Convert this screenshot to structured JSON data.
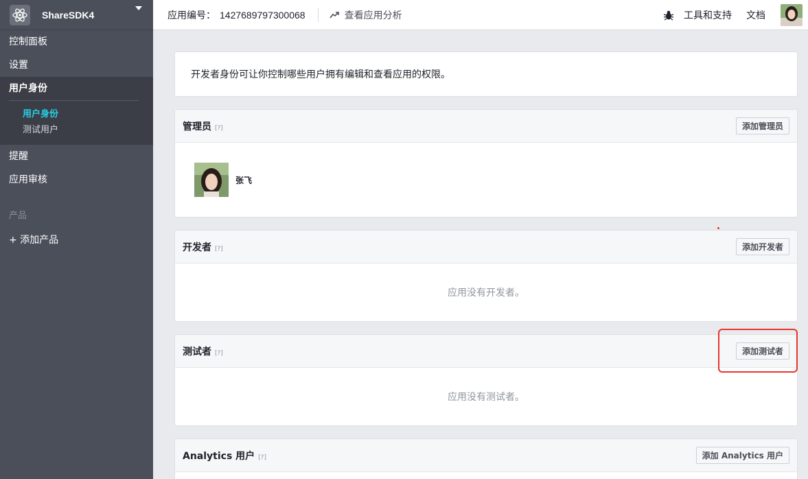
{
  "sidebar": {
    "app_name": "ShareSDK4",
    "items": [
      {
        "label": "控制面板"
      },
      {
        "label": "设置"
      }
    ],
    "active_group": {
      "label": "用户身份",
      "subitems": [
        {
          "label": "用户身份",
          "active": true
        },
        {
          "label": "测试用户",
          "active": false
        }
      ]
    },
    "items_after": [
      {
        "label": "提醒"
      },
      {
        "label": "应用审核"
      }
    ],
    "section_label": "产品",
    "add_product": "+ 添加产品"
  },
  "topbar": {
    "appid_label": "应用编号：",
    "appid_value": "1427689797300068",
    "analytics_link": "查看应用分析",
    "tools_link": "工具和支持",
    "docs_link": "文档"
  },
  "intro": {
    "text": "开发者身份可让你控制哪些用户拥有编辑和查看应用的权限。"
  },
  "sections": {
    "admins": {
      "title": "管理员",
      "help": "[?]",
      "button": "添加管理员",
      "user_name": "张飞"
    },
    "developers": {
      "title": "开发者",
      "help": "[?]",
      "button": "添加开发者",
      "empty": "应用没有开发者。"
    },
    "testers": {
      "title": "测试者",
      "help": "[?]",
      "button": "添加测试者",
      "empty": "应用没有测试者。"
    },
    "analytics": {
      "title": "Analytics 用户",
      "help": "[?]",
      "button": "添加 Analytics 用户"
    }
  },
  "colors": {
    "sidebar_bg": "#4b4f5a",
    "active_sub": "#27d1e6",
    "highlight": "#e8352b"
  },
  "icons": {
    "logo": "atom-icon",
    "analytics": "trend-up-icon",
    "bug": "bug-icon"
  }
}
